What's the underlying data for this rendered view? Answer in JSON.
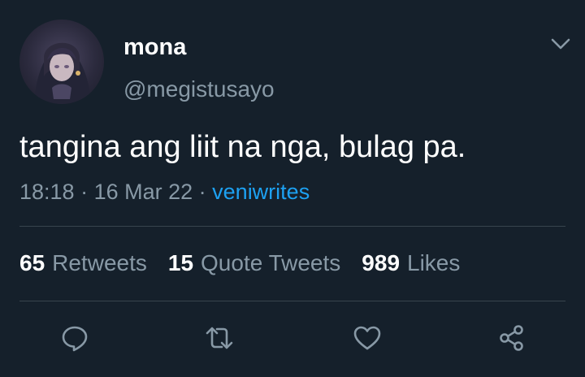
{
  "tweet": {
    "author_name": "mona",
    "author_handle": "@megistusayo",
    "text": "tangina ang liit na nga, bulag pa.",
    "time": "18:18",
    "date": "16 Mar 22",
    "source": "veniwrites",
    "separator": " · "
  },
  "stats": {
    "retweets_count": "65",
    "retweets_label": "Retweets",
    "quotes_count": "15",
    "quotes_label": "Quote Tweets",
    "likes_count": "989",
    "likes_label": "Likes"
  },
  "actions": [
    "reply-icon",
    "retweet-icon",
    "like-icon",
    "share-icon"
  ],
  "colors": {
    "background": "#15202b",
    "text_primary": "#ffffff",
    "text_secondary": "#8899a6",
    "link": "#1da1f2",
    "divider": "#38444d"
  }
}
